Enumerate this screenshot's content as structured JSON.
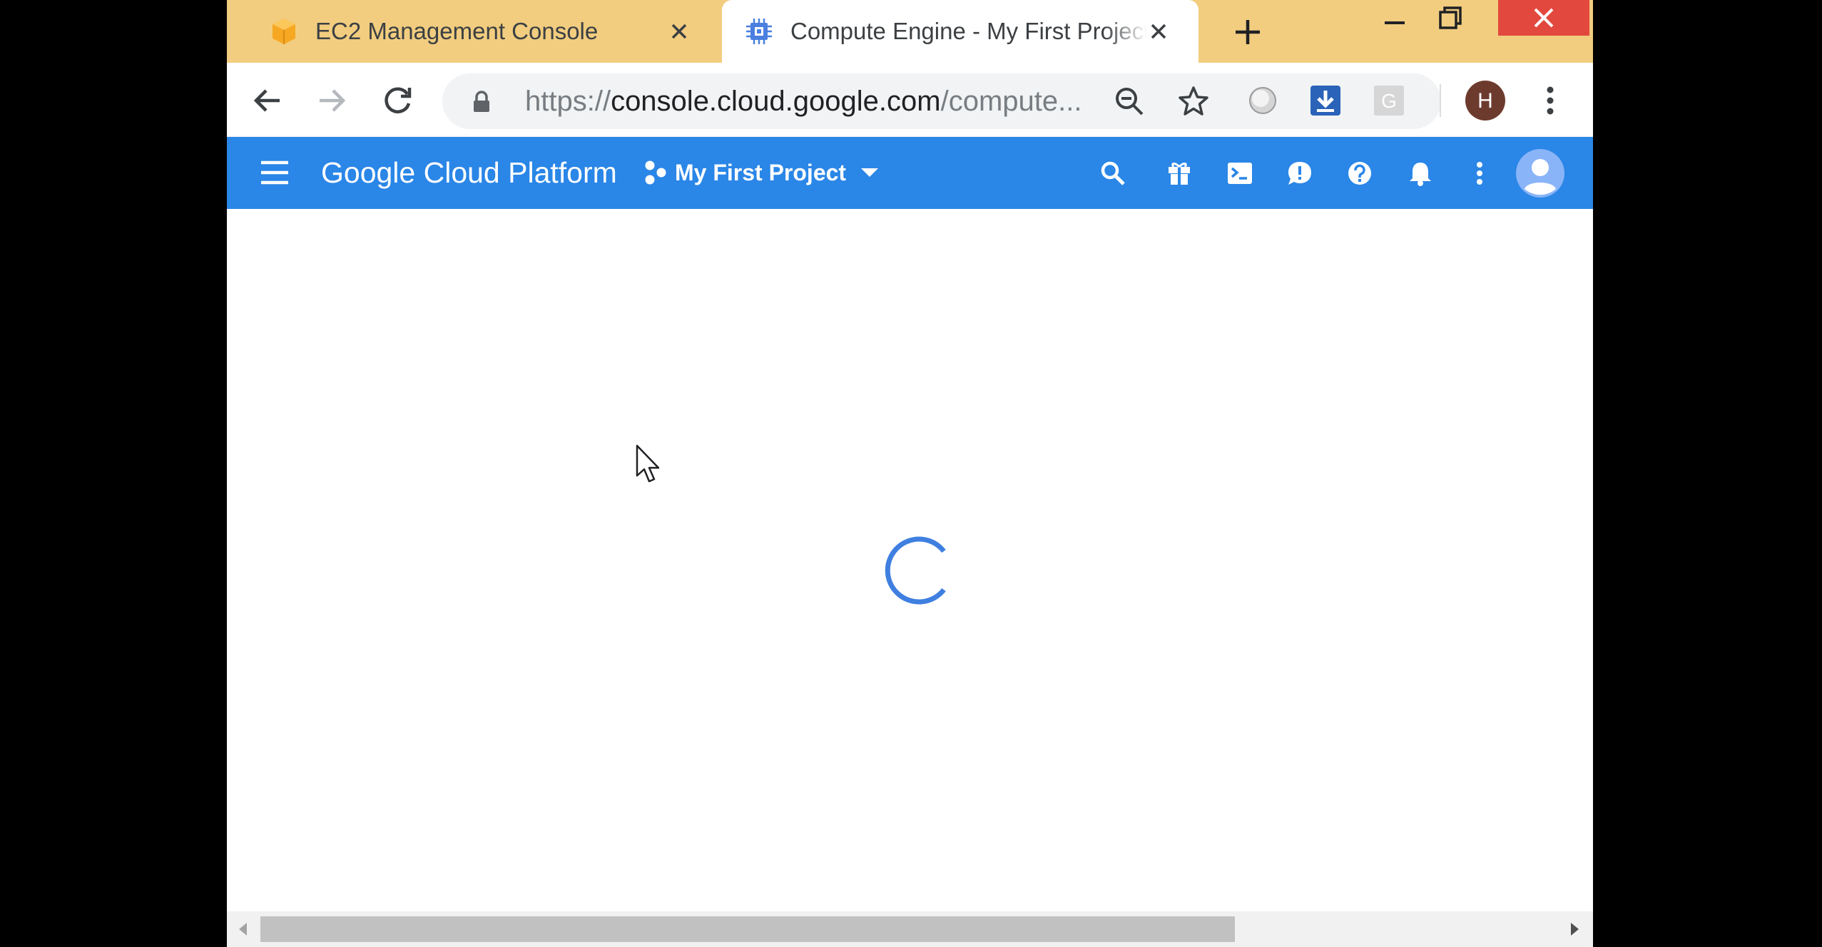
{
  "browser": {
    "tabs": [
      {
        "title": "EC2 Management Console",
        "favicon": "aws-box-icon",
        "active": false
      },
      {
        "title": "Compute Engine - My First Project",
        "favicon": "compute-engine-chip-icon",
        "active": true
      }
    ],
    "address": {
      "scheme": "https://",
      "host": "console.cloud.google.com",
      "path": "/compute..."
    },
    "profile_initial": "H",
    "extension_g_label": "G"
  },
  "gcp": {
    "title": "Google Cloud Platform",
    "project": "My First Project",
    "icons": [
      "search-icon",
      "gift-icon",
      "cloud-shell-icon",
      "feedback-icon",
      "help-icon",
      "notifications-icon",
      "more-vert-icon",
      "account-avatar-icon"
    ]
  },
  "content": {
    "state": "loading"
  },
  "colors": {
    "tabstrip": "#f2cd7f",
    "gcp_header": "#2a86e7",
    "spinner": "#3f7fe0",
    "close_button": "#e2483e",
    "avatar_profile": "#6d3b2e"
  },
  "scrollbar": {
    "horizontal_thumb_fraction": 0.75
  }
}
